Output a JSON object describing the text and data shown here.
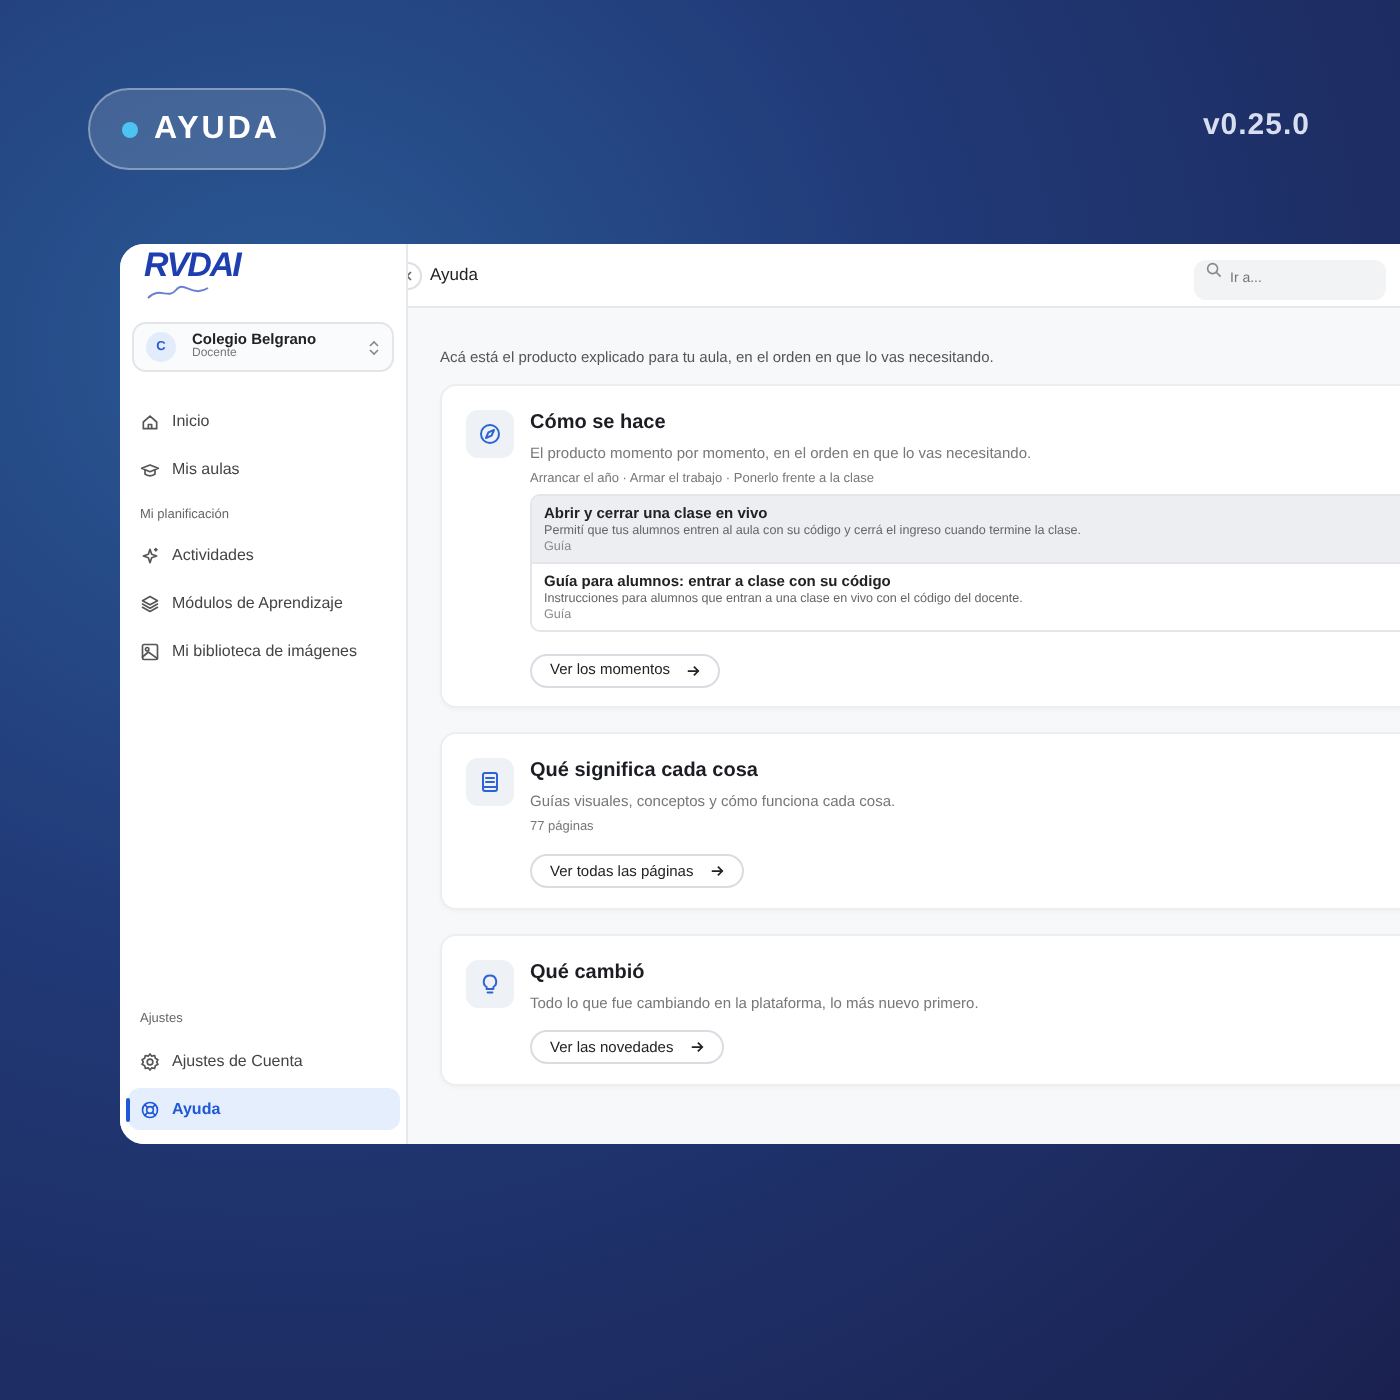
{
  "badge": {
    "label": "AYUDA"
  },
  "version": "v0.25.0",
  "logo": {
    "text": "RVDAI"
  },
  "org": {
    "initial": "C",
    "name": "Colegio Belgrano",
    "role": "Docente"
  },
  "sidebar": {
    "groups": [
      {
        "items": [
          {
            "label": "Inicio",
            "selected": false
          },
          {
            "label": "Mis aulas",
            "selected": false
          }
        ]
      },
      {
        "heading": "Mi planificación",
        "items": [
          {
            "label": "Actividades",
            "selected": false
          },
          {
            "label": "Módulos de Aprendizaje",
            "selected": false
          },
          {
            "label": "Mi biblioteca de imágenes",
            "selected": false
          }
        ]
      }
    ],
    "bottom_group": {
      "heading": "Ajustes",
      "items": [
        {
          "label": "Ajustes de Cuenta",
          "selected": false
        },
        {
          "label": "Ayuda",
          "selected": true
        }
      ]
    }
  },
  "header": {
    "title": "Ayuda",
    "search": {
      "placeholder": "Ir a..."
    }
  },
  "intro": "Acá está el producto explicado para tu aula, en el orden en que lo vas necesitando.",
  "cards": [
    {
      "title": "Cómo se hace",
      "description": "El producto momento por momento, en el orden en que lo vas necesitando.",
      "meta": "Arrancar el año · Armar el trabajo · Ponerlo frente a la clase",
      "items": [
        {
          "title": "Abrir y cerrar una clase en vivo",
          "description": "Permití que tus alumnos entren al aula con su código y cerrá el ingreso cuando termine la clase.",
          "tag": "Guía",
          "selected": true
        },
        {
          "title": "Guía para alumnos: entrar a clase con su código",
          "description": "Instrucciones para alumnos que entran a una clase en vivo con el código del docente.",
          "tag": "Guía",
          "selected": false
        }
      ],
      "button": "Ver los momentos"
    },
    {
      "title": "Qué significa cada cosa",
      "description": "Guías visuales, conceptos y cómo funciona cada cosa.",
      "meta": "77 páginas",
      "button": "Ver todas las páginas"
    },
    {
      "title": "Qué cambió",
      "description": "Todo lo que fue cambiando en la plataforma, lo más nuevo primero.",
      "button": "Ver las novedades"
    }
  ]
}
